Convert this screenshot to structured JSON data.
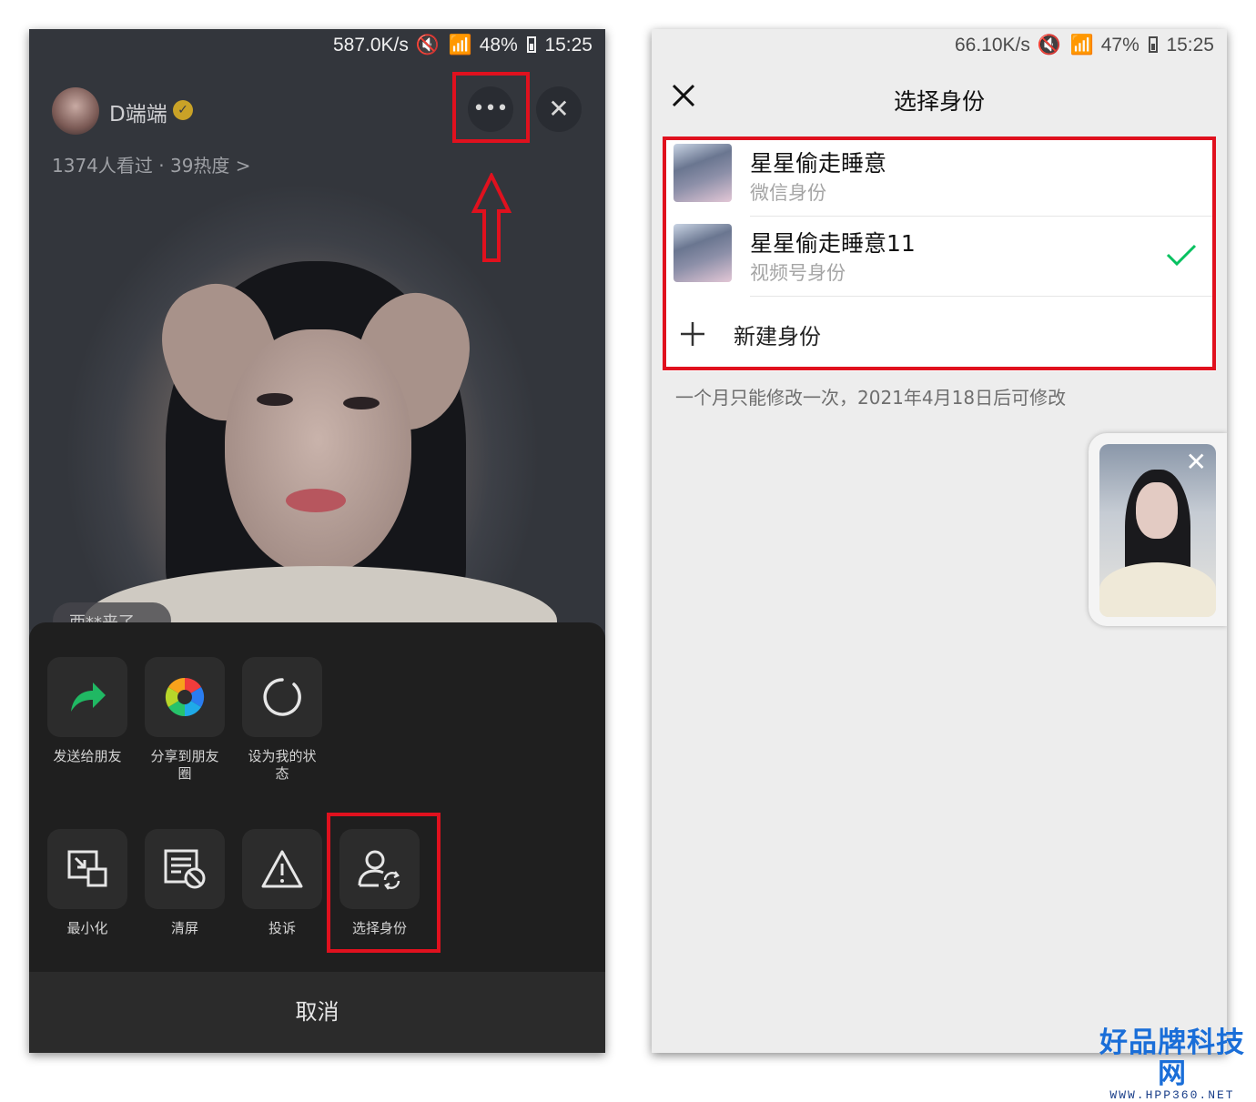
{
  "left": {
    "status": {
      "speed": "587.0K/s",
      "battery": "48%",
      "time": "15:25"
    },
    "host": {
      "name": "D端端",
      "viewers": "1374人看过 · 39热度 >"
    },
    "comment_pill": "西**来了",
    "menu_row1": [
      {
        "label": "发送给朋友",
        "icon": "share-arrow-icon"
      },
      {
        "label": "分享到朋友\n圈",
        "icon": "moments-aperture-icon"
      },
      {
        "label": "设为我的状\n态",
        "icon": "status-ring-icon"
      }
    ],
    "menu_row2": [
      {
        "label": "最小化",
        "icon": "minimize-icon"
      },
      {
        "label": "清屏",
        "icon": "clear-screen-icon"
      },
      {
        "label": "投诉",
        "icon": "warning-icon"
      },
      {
        "label": "选择身份",
        "icon": "switch-identity-icon"
      }
    ],
    "cancel": "取消"
  },
  "right": {
    "status": {
      "speed": "66.10K/s",
      "battery": "47%",
      "time": "15:25"
    },
    "title": "选择身份",
    "identities": [
      {
        "name": "星星偷走睡意",
        "type": "微信身份",
        "selected": false
      },
      {
        "name": "星星偷走睡意11",
        "type": "视频号身份",
        "selected": true
      }
    ],
    "new_identity": "新建身份",
    "footnote": "一个月只能修改一次，2021年4月18日后可修改"
  },
  "watermark": {
    "main": "好品牌科技网",
    "sub": "WWW.HPP360.NET"
  },
  "colors": {
    "highlight": "#e0111e",
    "check": "#07c160",
    "wechat_green": "#2aae67"
  }
}
